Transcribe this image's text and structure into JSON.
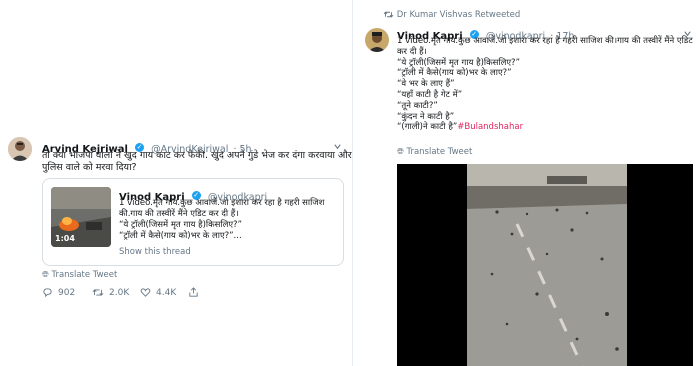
{
  "left_tweet": {
    "name": "Arvind Kejriwal",
    "handle": "@ArvindKejriwal",
    "time": "· 5h",
    "text_lines": [
      "तो क्या भाजपा वालों ने खुद गाय काट कर फेकी. खुद अपने गुंडे भेज कर दंगा करवाया और फिर",
      "पुलिस वाले को मरवा दिया?"
    ],
    "quote": {
      "name": "Vinod Kapri",
      "handle": "@vinodkapri",
      "lines": [
        "1 video.मृत गाय.कुछ आवाजें.जो इशारा कर रहा है गहरी साजिश",
        "की.गाय की तस्वीरें मैंने एडिट कर दी हैं।",
        "“ये ट्रॉली(जिसमें मृत गाय है)किसलिए?”",
        "“ट्रॉली में कैसे(गाय को)भर के लाए?”..."
      ],
      "show_thread": "Show this thread",
      "video_duration": "1:04"
    },
    "translate": "Translate Tweet",
    "actions": {
      "replies": "902",
      "retweets": "2.0K",
      "likes": "4.4K"
    }
  },
  "right_tweet": {
    "retweeted_by": "Dr Kumar Vishvas Retweeted",
    "name": "Vinod Kapri",
    "handle": "@vinodkapri",
    "time": "· 17h",
    "text_lines": [
      "1 video.मृत गाय.कुछ आवाजें.जो इशारा कर रहा है गहरी साजिश की।गाय की तस्वीरें मैंने एडिट",
      "कर दी हैं।",
      "“ये ट्रॉली(जिसमें मृत गाय है)किसलिए?”",
      "“ट्रॉली में कैसे(गाय को)भर के लाए?”",
      "“वे भर के लाए हैं”",
      "“यहाँ काटी है गेट में”",
      "“तूने काटी?”",
      "“कुंदन ने काटी है”",
      "“(गाली)ने काटी है”"
    ],
    "hashtag": "#Bulandshahar",
    "translate": "Translate Tweet"
  },
  "colors": {
    "accent": "#1da1f2",
    "hashtag": "#e0245e",
    "muted": "#657786"
  }
}
